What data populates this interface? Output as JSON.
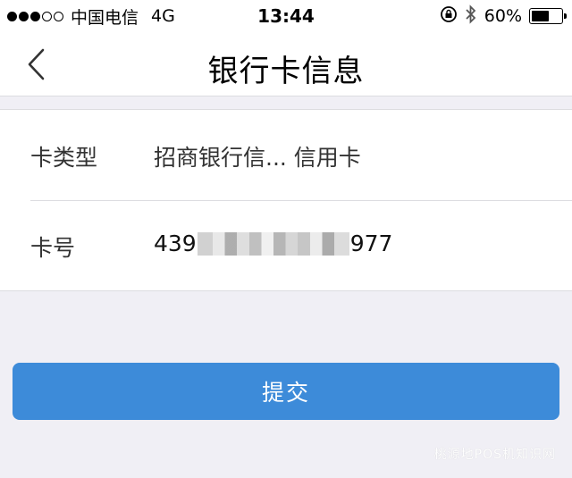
{
  "status_bar": {
    "carrier": "中国电信",
    "network": "4G",
    "time": "13:44",
    "battery_percent": "60%",
    "battery_level": 0.6,
    "signal_bars": 3,
    "signal_total": 5
  },
  "nav": {
    "title": "银行卡信息"
  },
  "card_info": {
    "type_label": "卡类型",
    "type_value": "招商银行信...   信用卡",
    "number_label": "卡号",
    "number_prefix": "439",
    "number_suffix": "977"
  },
  "actions": {
    "submit_label": "提交"
  },
  "watermark": "桃源地POS机知识网",
  "colors": {
    "primary_button": "#3d8bd9",
    "background": "#f0eff5"
  }
}
